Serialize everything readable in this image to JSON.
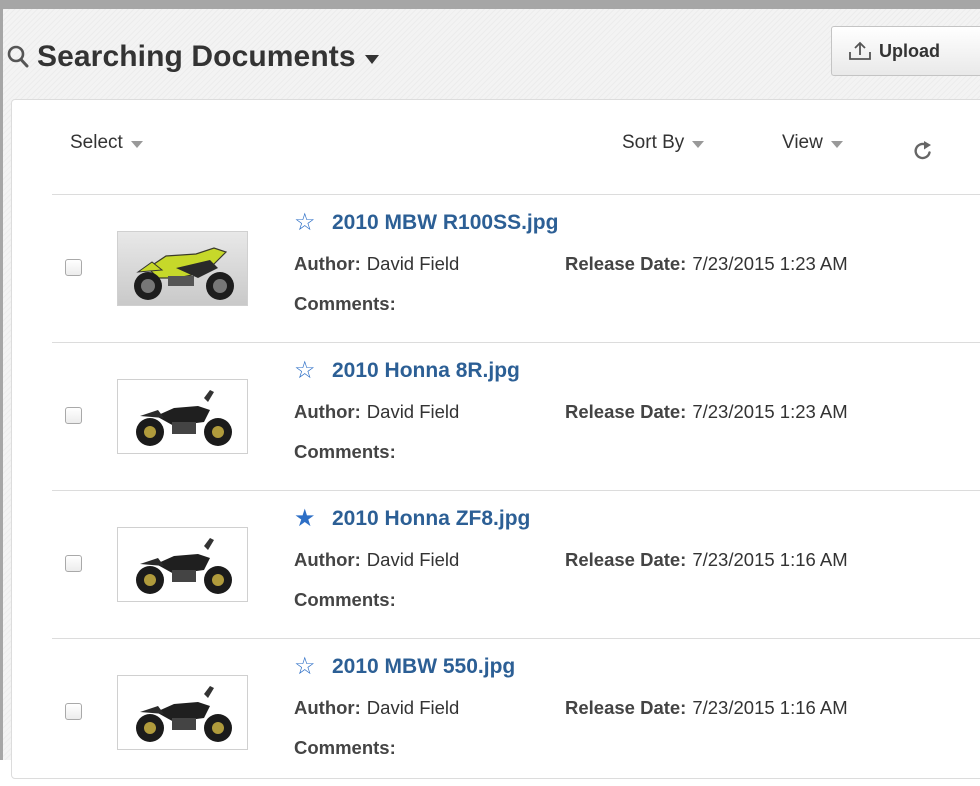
{
  "header": {
    "title": "Searching Documents",
    "upload_label": "Upload"
  },
  "toolbar": {
    "select_label": "Select",
    "sort_label": "Sort By",
    "view_label": "View"
  },
  "labels": {
    "author": "Author:",
    "release_date": "Release Date:",
    "comments": "Comments:"
  },
  "documents": [
    {
      "name": "2010 MBW R100SS.jpg",
      "author": "David Field",
      "release_date": "7/23/2015 1:23 AM",
      "favorite": false,
      "thumbnail": "yellow-sport-motorcycle"
    },
    {
      "name": "2010 Honna 8R.jpg",
      "author": "David Field",
      "release_date": "7/23/2015 1:23 AM",
      "favorite": false,
      "thumbnail": "black-naked-motorcycle"
    },
    {
      "name": "2010 Honna ZF8.jpg",
      "author": "David Field",
      "release_date": "7/23/2015 1:16 AM",
      "favorite": true,
      "thumbnail": "black-naked-motorcycle"
    },
    {
      "name": "2010 MBW 550.jpg",
      "author": "David Field",
      "release_date": "7/23/2015 1:16 AM",
      "favorite": false,
      "thumbnail": "black-naked-motorcycle"
    }
  ],
  "icons": {
    "favorite_on": "★",
    "favorite_off": "☆"
  },
  "colors": {
    "link": "#2c5f95",
    "star": "#2d6fc6"
  }
}
